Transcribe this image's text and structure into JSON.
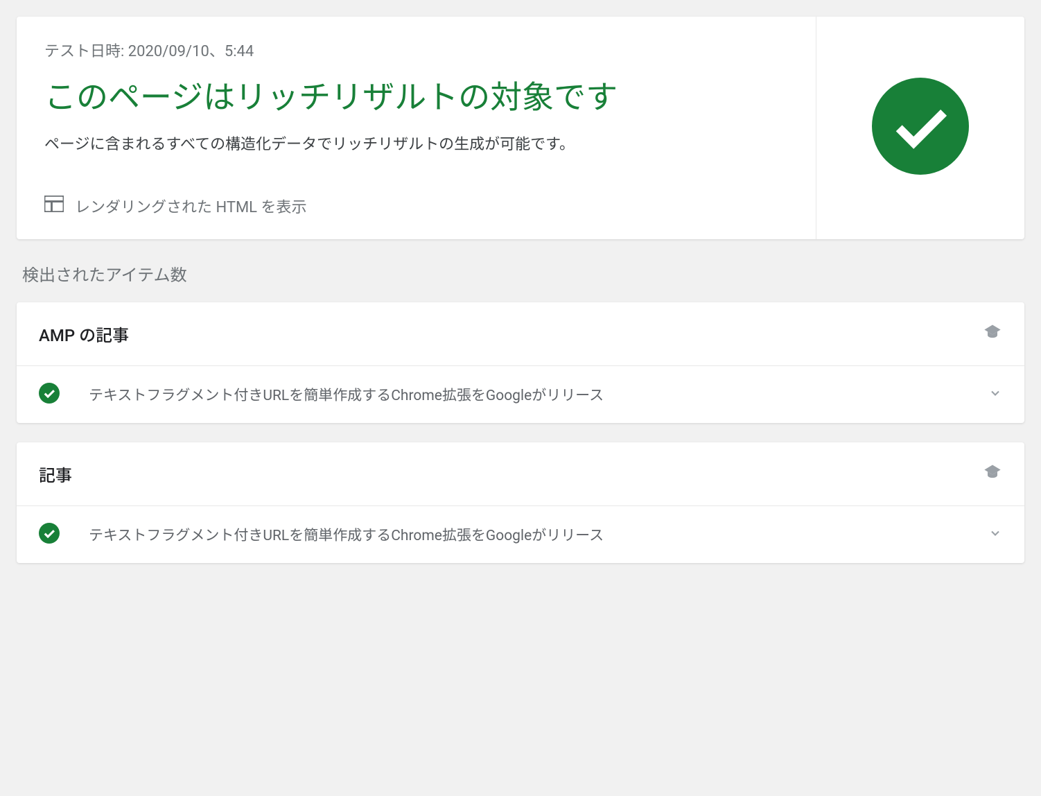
{
  "result": {
    "timestamp": "テスト日時: 2020/09/10、5:44",
    "title": "このページはリッチリザルトの対象です",
    "description": "ページに含まれるすべての構造化データでリッチリザルトの生成が可能です。",
    "view_rendered_label": "レンダリングされた HTML を表示"
  },
  "section": {
    "header": "検出されたアイテム数"
  },
  "items": [
    {
      "title": "AMP の記事",
      "row_text": "テキストフラグメント付きURLを簡単作成するChrome拡張をGoogleがリリース"
    },
    {
      "title": "記事",
      "row_text": "テキストフラグメント付きURLを簡単作成するChrome拡張をGoogleがリリース"
    }
  ],
  "colors": {
    "success": "#188038",
    "muted": "#9aa0a6"
  }
}
